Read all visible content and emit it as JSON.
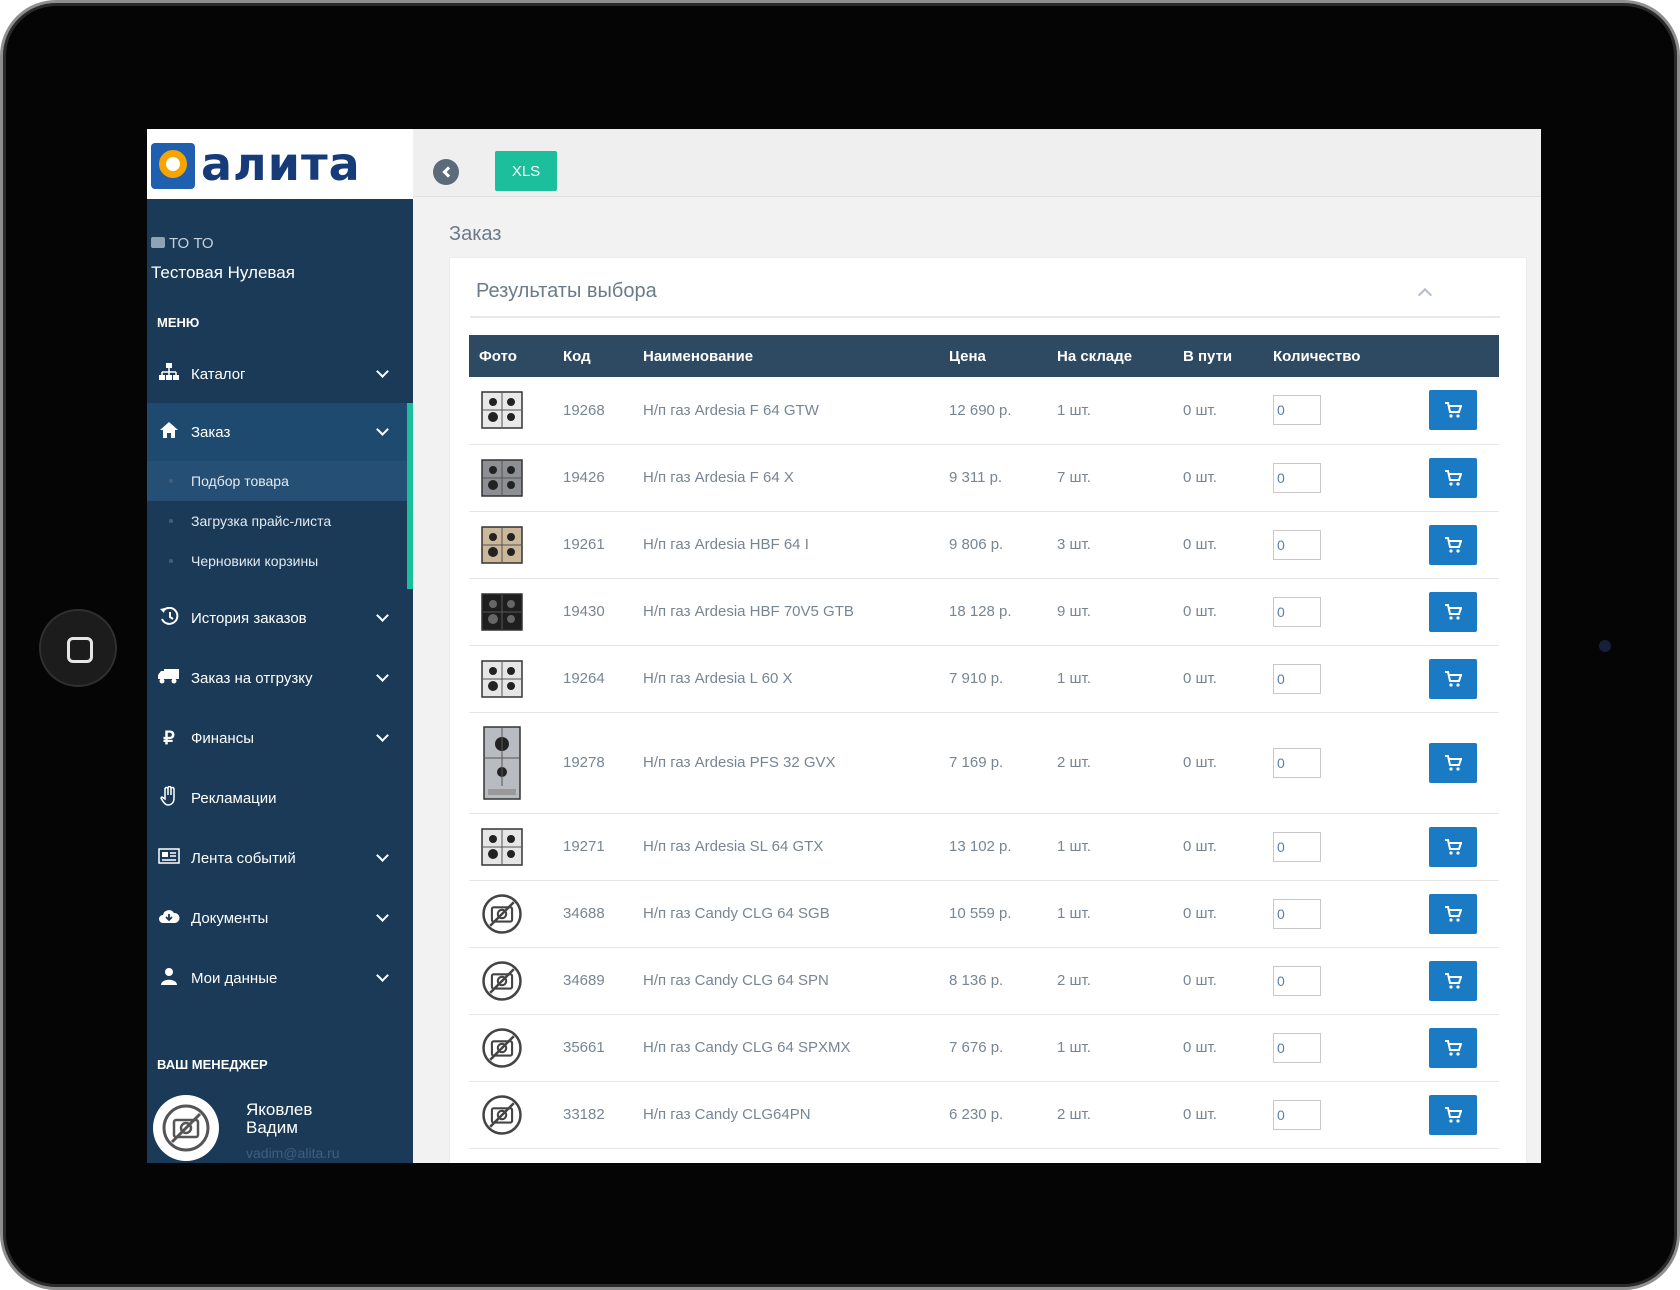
{
  "brand": {
    "logo_text": "алита"
  },
  "company": {
    "short": "ТО ТО",
    "name": "Тестовая Нулевая"
  },
  "menu": {
    "title": "МЕНЮ",
    "items": [
      {
        "label": "Каталог",
        "icon": "sitemap-icon"
      },
      {
        "label": "Заказ",
        "icon": "home-icon"
      },
      {
        "label": "История заказов",
        "icon": "history-icon"
      },
      {
        "label": "Заказ на отгрузку",
        "icon": "truck-icon"
      },
      {
        "label": "Финансы",
        "icon": "ruble-icon"
      },
      {
        "label": "Рекламации",
        "icon": "hand-icon"
      },
      {
        "label": "Лента событий",
        "icon": "newspaper-icon"
      },
      {
        "label": "Документы",
        "icon": "cloud-download-icon"
      },
      {
        "label": "Мои данные",
        "icon": "user-icon"
      }
    ],
    "subitems": [
      {
        "label": "Подбор товара"
      },
      {
        "label": "Загрузка прайс-листа"
      },
      {
        "label": "Черновики корзины"
      }
    ]
  },
  "manager": {
    "title": "ВАШ МЕНЕДЖЕР",
    "name": "Яковлев Вадим",
    "email": "vadim@alita.ru"
  },
  "toolbar": {
    "xls_label": "XLS"
  },
  "page": {
    "title": "Заказ",
    "panel_title": "Результаты выбора"
  },
  "table": {
    "headers": [
      "Фото",
      "Код",
      "Наименование",
      "Цена",
      "На складе",
      "В пути",
      "Количество",
      ""
    ],
    "rows": [
      {
        "photo": "hob-dark",
        "code": "19268",
        "name": "Н/п газ Ardesia F 64 GTW",
        "price": "12 690 р.",
        "stock": "1 шт.",
        "transit": "0 шт.",
        "qty": "0"
      },
      {
        "photo": "hob-steel",
        "code": "19426",
        "name": "Н/п газ Ardesia F 64 X",
        "price": "9 311 р.",
        "stock": "7 шт.",
        "transit": "0 шт.",
        "qty": "0"
      },
      {
        "photo": "hob-beige",
        "code": "19261",
        "name": "Н/п газ Ardesia HBF 64 I",
        "price": "9 806 р.",
        "stock": "3 шт.",
        "transit": "0 шт.",
        "qty": "0"
      },
      {
        "photo": "hob-black",
        "code": "19430",
        "name": "Н/п газ Ardesia HBF 70V5 GTB",
        "price": "18 128 р.",
        "stock": "9 шт.",
        "transit": "0 шт.",
        "qty": "0"
      },
      {
        "photo": "hob-grid",
        "code": "19264",
        "name": "Н/п газ Ardesia L 60 X",
        "price": "7 910 р.",
        "stock": "1 шт.",
        "transit": "0 шт.",
        "qty": "0"
      },
      {
        "photo": "hob-domino",
        "code": "19278",
        "name": "Н/п газ Ardesia PFS 32 GVX",
        "price": "7 169 р.",
        "stock": "2 шт.",
        "transit": "0 шт.",
        "qty": "0"
      },
      {
        "photo": "hob-small",
        "code": "19271",
        "name": "Н/п газ Ardesia SL 64 GTX",
        "price": "13 102 р.",
        "stock": "1 шт.",
        "transit": "0 шт.",
        "qty": "0"
      },
      {
        "photo": "no-photo",
        "code": "34688",
        "name": "Н/п газ Candy CLG 64 SGB",
        "price": "10 559 р.",
        "stock": "1 шт.",
        "transit": "0 шт.",
        "qty": "0"
      },
      {
        "photo": "no-photo",
        "code": "34689",
        "name": "Н/п газ Candy CLG 64 SPN",
        "price": "8 136 р.",
        "stock": "2 шт.",
        "transit": "0 шт.",
        "qty": "0"
      },
      {
        "photo": "no-photo",
        "code": "35661",
        "name": "Н/п газ Candy CLG 64 SPXMX",
        "price": "7 676 р.",
        "stock": "1 шт.",
        "transit": "0 шт.",
        "qty": "0"
      },
      {
        "photo": "no-photo",
        "code": "33182",
        "name": "Н/п газ Candy CLG64PN",
        "price": "6 230 р.",
        "stock": "2 шт.",
        "transit": "0 шт.",
        "qty": "0"
      }
    ]
  },
  "colors": {
    "sidebar": "#1a3a58",
    "accent": "#1bbf9b",
    "table_header": "#2e4a63",
    "cart": "#1a7bc4"
  }
}
